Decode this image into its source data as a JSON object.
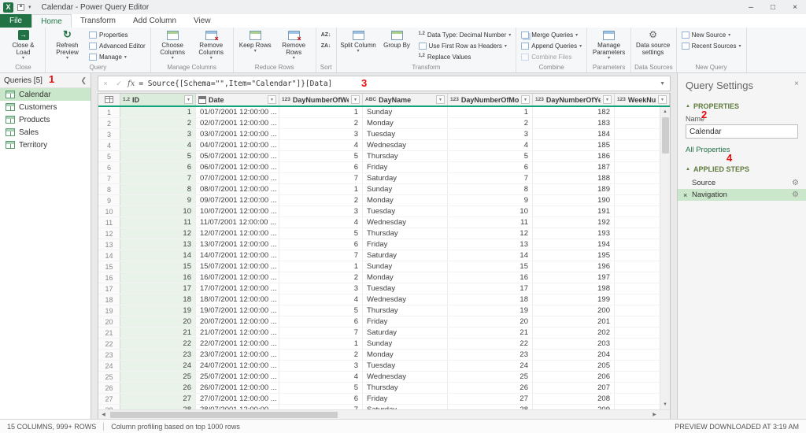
{
  "colors": {
    "excel_green": "#217346",
    "header_accent": "#0fa379",
    "selection_green": "#cbe7cb",
    "column_tint": "#e9f3e9",
    "annotation_red": "#e80c0c",
    "section_header": "#5f7a3d"
  },
  "title_bar": {
    "title": "Calendar - Power Query Editor"
  },
  "tab_bar": {
    "file": "File",
    "tabs": [
      "Home",
      "Transform",
      "Add Column",
      "View"
    ],
    "selected": "Home"
  },
  "ribbon": {
    "close_load": "Close & Load",
    "refresh_preview": "Refresh Preview",
    "properties": "Properties",
    "advanced_editor": "Advanced Editor",
    "manage": "Manage",
    "choose_columns": "Choose Columns",
    "remove_columns": "Remove Columns",
    "keep_rows": "Keep Rows",
    "remove_rows": "Remove Rows",
    "split_column": "Split Column",
    "group_by": "Group By",
    "data_type": "Data Type: Decimal Number",
    "use_first_row": "Use First Row as Headers",
    "replace_values": "Replace Values",
    "merge_queries": "Merge Queries",
    "append_queries": "Append Queries",
    "combine_files": "Combine Files",
    "manage_parameters": "Manage Parameters",
    "data_source_settings": "Data source settings",
    "new_source": "New Source",
    "recent_sources": "Recent Sources",
    "groups": {
      "close": "Close",
      "query": "Query",
      "manage_columns": "Manage Columns",
      "reduce_rows": "Reduce Rows",
      "sort": "Sort",
      "transform": "Transform",
      "combine": "Combine",
      "parameters": "Parameters",
      "data_sources": "Data Sources",
      "new_query": "New Query"
    }
  },
  "sidebar": {
    "header": "Queries [5]",
    "items": [
      "Calendar",
      "Customers",
      "Products",
      "Sales",
      "Territory"
    ],
    "selected": "Calendar"
  },
  "formula_bar": {
    "formula": "= Source{[Schema=\"\",Item=\"Calendar\"]}[Data]"
  },
  "grid": {
    "columns": [
      {
        "icon": "1.2",
        "icon_name": "decimal-type-icon",
        "label": "ID",
        "selected": true
      },
      {
        "icon": "",
        "icon_name": "calendar-type-icon",
        "label": "Date"
      },
      {
        "icon": "123",
        "icon_name": "whole-number-type-icon",
        "label": "DayNumberOfWeek"
      },
      {
        "icon": "ABC",
        "icon_name": "text-type-icon",
        "label": "DayName"
      },
      {
        "icon": "123",
        "icon_name": "whole-number-type-icon",
        "label": "DayNumberOfMonth"
      },
      {
        "icon": "123",
        "icon_name": "whole-number-type-icon",
        "label": "DayNumberOfYear"
      },
      {
        "icon": "123",
        "icon_name": "whole-number-type-icon",
        "label": "WeekNumber"
      }
    ],
    "rows": [
      [
        1,
        "01/07/2001 12:00:00 ...",
        1,
        "Sunday",
        1,
        182,
        ""
      ],
      [
        2,
        "02/07/2001 12:00:00 ...",
        2,
        "Monday",
        2,
        183,
        ""
      ],
      [
        3,
        "03/07/2001 12:00:00 ...",
        3,
        "Tuesday",
        3,
        184,
        ""
      ],
      [
        4,
        "04/07/2001 12:00:00 ...",
        4,
        "Wednesday",
        4,
        185,
        ""
      ],
      [
        5,
        "05/07/2001 12:00:00 ...",
        5,
        "Thursday",
        5,
        186,
        ""
      ],
      [
        6,
        "06/07/2001 12:00:00 ...",
        6,
        "Friday",
        6,
        187,
        ""
      ],
      [
        7,
        "07/07/2001 12:00:00 ...",
        7,
        "Saturday",
        7,
        188,
        ""
      ],
      [
        8,
        "08/07/2001 12:00:00 ...",
        1,
        "Sunday",
        8,
        189,
        ""
      ],
      [
        9,
        "09/07/2001 12:00:00 ...",
        2,
        "Monday",
        9,
        190,
        ""
      ],
      [
        10,
        "10/07/2001 12:00:00 ...",
        3,
        "Tuesday",
        10,
        191,
        ""
      ],
      [
        11,
        "11/07/2001 12:00:00 ...",
        4,
        "Wednesday",
        11,
        192,
        ""
      ],
      [
        12,
        "12/07/2001 12:00:00 ...",
        5,
        "Thursday",
        12,
        193,
        ""
      ],
      [
        13,
        "13/07/2001 12:00:00 ...",
        6,
        "Friday",
        13,
        194,
        ""
      ],
      [
        14,
        "14/07/2001 12:00:00 ...",
        7,
        "Saturday",
        14,
        195,
        ""
      ],
      [
        15,
        "15/07/2001 12:00:00 ...",
        1,
        "Sunday",
        15,
        196,
        ""
      ],
      [
        16,
        "16/07/2001 12:00:00 ...",
        2,
        "Monday",
        16,
        197,
        ""
      ],
      [
        17,
        "17/07/2001 12:00:00 ...",
        3,
        "Tuesday",
        17,
        198,
        ""
      ],
      [
        18,
        "18/07/2001 12:00:00 ...",
        4,
        "Wednesday",
        18,
        199,
        ""
      ],
      [
        19,
        "19/07/2001 12:00:00 ...",
        5,
        "Thursday",
        19,
        200,
        ""
      ],
      [
        20,
        "20/07/2001 12:00:00 ...",
        6,
        "Friday",
        20,
        201,
        ""
      ],
      [
        21,
        "21/07/2001 12:00:00 ...",
        7,
        "Saturday",
        21,
        202,
        ""
      ],
      [
        22,
        "22/07/2001 12:00:00 ...",
        1,
        "Sunday",
        22,
        203,
        ""
      ],
      [
        23,
        "23/07/2001 12:00:00 ...",
        2,
        "Monday",
        23,
        204,
        ""
      ],
      [
        24,
        "24/07/2001 12:00:00 ...",
        3,
        "Tuesday",
        24,
        205,
        ""
      ],
      [
        25,
        "25/07/2001 12:00:00 ...",
        4,
        "Wednesday",
        25,
        206,
        ""
      ],
      [
        26,
        "26/07/2001 12:00:00 ...",
        5,
        "Thursday",
        26,
        207,
        ""
      ],
      [
        27,
        "27/07/2001 12:00:00 ...",
        6,
        "Friday",
        27,
        208,
        ""
      ],
      [
        28,
        "28/07/2001 12:00:00 ...",
        7,
        "Saturday",
        28,
        209,
        ""
      ]
    ]
  },
  "query_settings": {
    "title": "Query Settings",
    "properties_header": "PROPERTIES",
    "name_label": "Name",
    "name_value": "Calendar",
    "all_properties": "All Properties",
    "applied_steps_header": "APPLIED STEPS",
    "steps": [
      {
        "label": "Source",
        "selected": false
      },
      {
        "label": "Navigation",
        "selected": true
      }
    ]
  },
  "status_bar": {
    "left": "15 COLUMNS, 999+ ROWS",
    "profiling": "Column profiling based on top 1000 rows",
    "right": "PREVIEW DOWNLOADED AT 3:19 AM"
  },
  "annotations": [
    "1",
    "2",
    "3",
    "4"
  ]
}
